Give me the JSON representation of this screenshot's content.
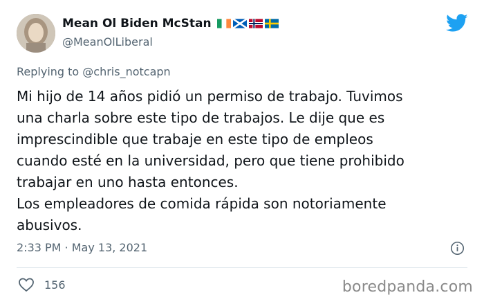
{
  "author": {
    "display_name": "Mean Ol Biden McStan",
    "handle": "@MeanOlLiberal"
  },
  "reply": {
    "text": "Replying to @chris_notcapn"
  },
  "tweet": {
    "text": "Mi hijo de 14 años pidió un permiso de trabajo. Tuvimos\nuna charla sobre este tipo de trabajos. Le dije que es\nimprescindible que trabaje en este tipo de empleos\ncuando esté en la universidad, pero que tiene prohibido\ntrabajar en uno hasta entonces.\nLos empleadores de comida rápida son notoriamente\nabusivos.",
    "timestamp": "2:33 PM · May 13, 2021",
    "likes": "156"
  },
  "watermark": "boredpanda.com",
  "colors": {
    "twitter_blue": "#1da1f2",
    "text": "#0f1419",
    "muted": "#536471"
  },
  "icons": {
    "logo": "twitter-bird-icon",
    "info": "info-icon",
    "like": "heart-icon",
    "flags": [
      "ireland-flag-icon",
      "scotland-flag-icon",
      "norway-flag-icon",
      "sweden-flag-icon"
    ]
  }
}
